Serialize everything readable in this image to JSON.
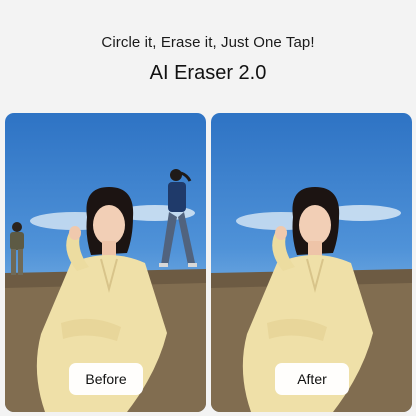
{
  "header": {
    "tagline": "Circle it, Erase it, Just One Tap!",
    "title": "AI Eraser 2.0"
  },
  "comparison": {
    "before_label": "Before",
    "after_label": "After"
  },
  "colors": {
    "background": "#f3f3f3",
    "sky": "#4f92d8",
    "dress": "#efe0a8",
    "label_chip": "#ffffff"
  }
}
